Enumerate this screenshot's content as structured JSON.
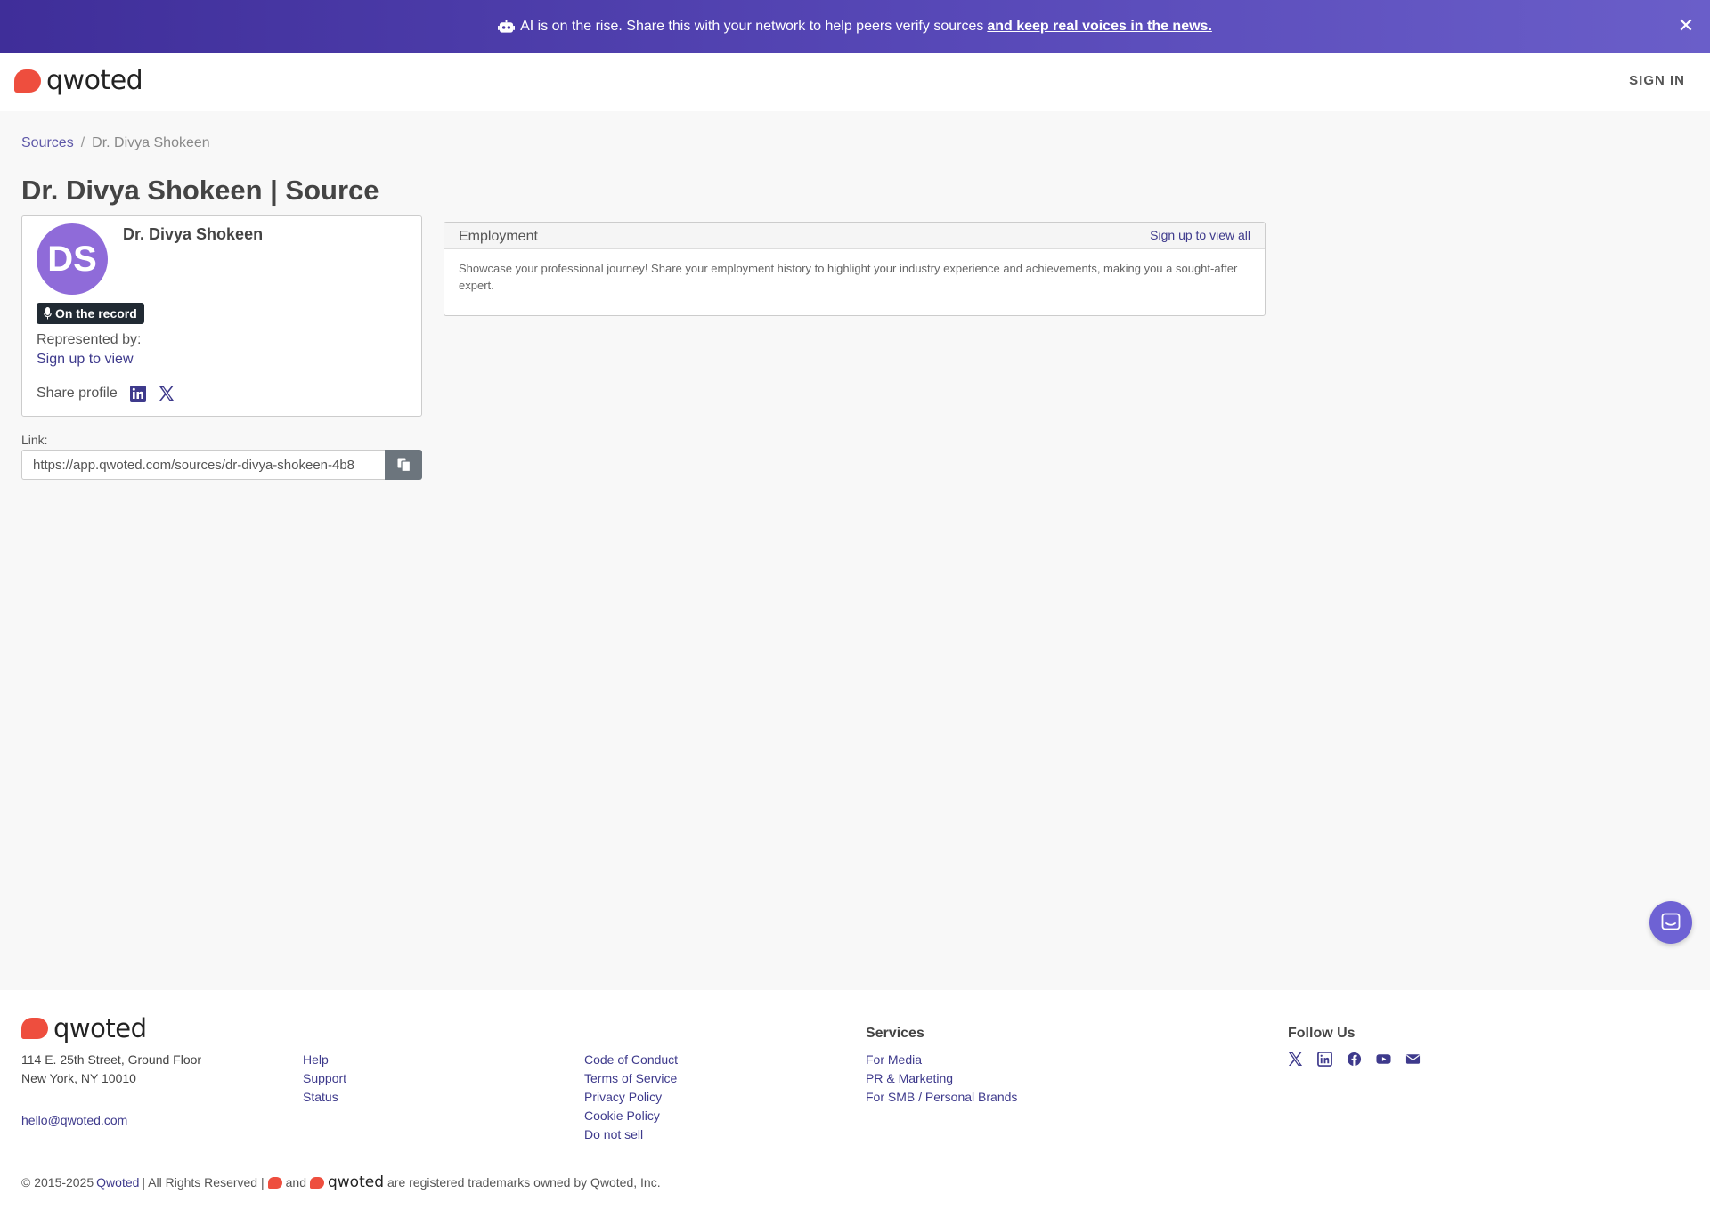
{
  "banner": {
    "message": "AI is on the rise. Share this with your network to help peers verify sources",
    "link": "and keep real voices in the news."
  },
  "nav": {
    "logo_text": "qwoted",
    "signin": "SIGN IN"
  },
  "breadcrumb": {
    "root": "Sources",
    "sep": "/",
    "current": "Dr. Divya Shokeen"
  },
  "page_title": "Dr. Divya Shokeen | Source",
  "profile": {
    "initials": "DS",
    "name": "Dr. Divya Shokeen",
    "badge": "On the record",
    "represented_label": "Represented by:",
    "represented_link": "Sign up to view",
    "share_label": "Share profile",
    "link_label": "Link:",
    "link_value": "https://app.qwoted.com/sources/dr-divya-shokeen-4b8"
  },
  "employment": {
    "title": "Employment",
    "signup": "Sign up to view all",
    "body": "Showcase your professional journey! Share your employment history to highlight your industry experience and achievements, making you a sought-after expert."
  },
  "footer": {
    "logo_text": "qwoted",
    "address_line1": "114 E. 25th Street, Ground Floor",
    "address_line2": "New York, NY 10010",
    "email": "hello@qwoted.com",
    "col1": [
      "Help",
      "Support",
      "Status"
    ],
    "col2": [
      "Code of Conduct",
      "Terms of Service",
      "Privacy Policy",
      "Cookie Policy",
      "Do not sell"
    ],
    "services_heading": "Services",
    "services": [
      "For Media",
      "PR & Marketing",
      "For SMB / Personal Brands"
    ],
    "follow_heading": "Follow Us",
    "copyright_prefix": "© 2015-2025",
    "copyright_link": "Qwoted",
    "copyright_mid": "| All Rights Reserved |",
    "copyright_and": "and",
    "copyright_word": "qwoted",
    "copyright_suffix": "are registered trademarks owned by Qwoted, Inc."
  },
  "colors": {
    "brand_red": "#ee4e3e",
    "brand_purple": "#3e3a8c",
    "avatar_purple": "#8f6bd9",
    "banner_start": "#3f2e99",
    "banner_end": "#6a5ec9"
  },
  "icons": [
    "robot-icon",
    "close-icon",
    "microphone-icon",
    "linkedin-icon",
    "x-twitter-icon",
    "copy-icon",
    "chat-icon",
    "facebook-icon",
    "youtube-icon",
    "envelope-icon"
  ]
}
